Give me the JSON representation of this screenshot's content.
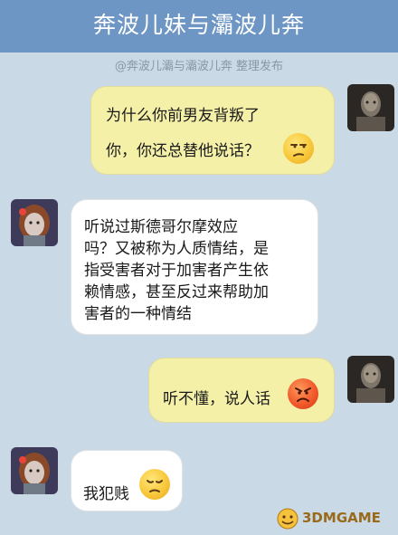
{
  "header": {
    "title": "奔波儿妹与灞波儿奔"
  },
  "subtitle": "@奔波儿灞与灞波儿奔 整理发布",
  "messages": [
    {
      "side": "right",
      "lines": [
        "为什么你前男友背叛了",
        "你，你还总替他说话？"
      ],
      "emoji": "unamused-face-icon"
    },
    {
      "side": "left",
      "lines": [
        "听说过斯德哥尔摩效应",
        "吗？又被称为人质情结，是",
        "指受害者对于加害者产生依",
        "赖情感，甚至反过来帮助加",
        "害者的一种情结"
      ]
    },
    {
      "side": "right",
      "lines": [
        "听不懂，说人话"
      ],
      "emoji": "angry-face-icon"
    },
    {
      "side": "left",
      "lines": [
        "我犯贱"
      ],
      "emoji": "pensive-face-icon"
    }
  ],
  "watermark": {
    "text": "3DMGAME"
  },
  "colors": {
    "header": "#6e96c4",
    "background": "#c9d9e5",
    "bubble_yellow": "#f4f0a8",
    "bubble_white": "#ffffff"
  }
}
